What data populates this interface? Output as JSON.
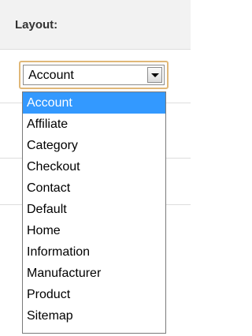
{
  "header": {
    "label": "Layout:"
  },
  "select": {
    "value": "Account",
    "options": [
      "Account",
      "Affiliate",
      "Category",
      "Checkout",
      "Contact",
      "Default",
      "Home",
      "Information",
      "Manufacturer",
      "Product",
      "Sitemap"
    ],
    "highlighted": "Account"
  },
  "colors": {
    "highlight": "#3399ff",
    "focus_border": "#e0b878",
    "header_bg": "#f2f2f2"
  }
}
